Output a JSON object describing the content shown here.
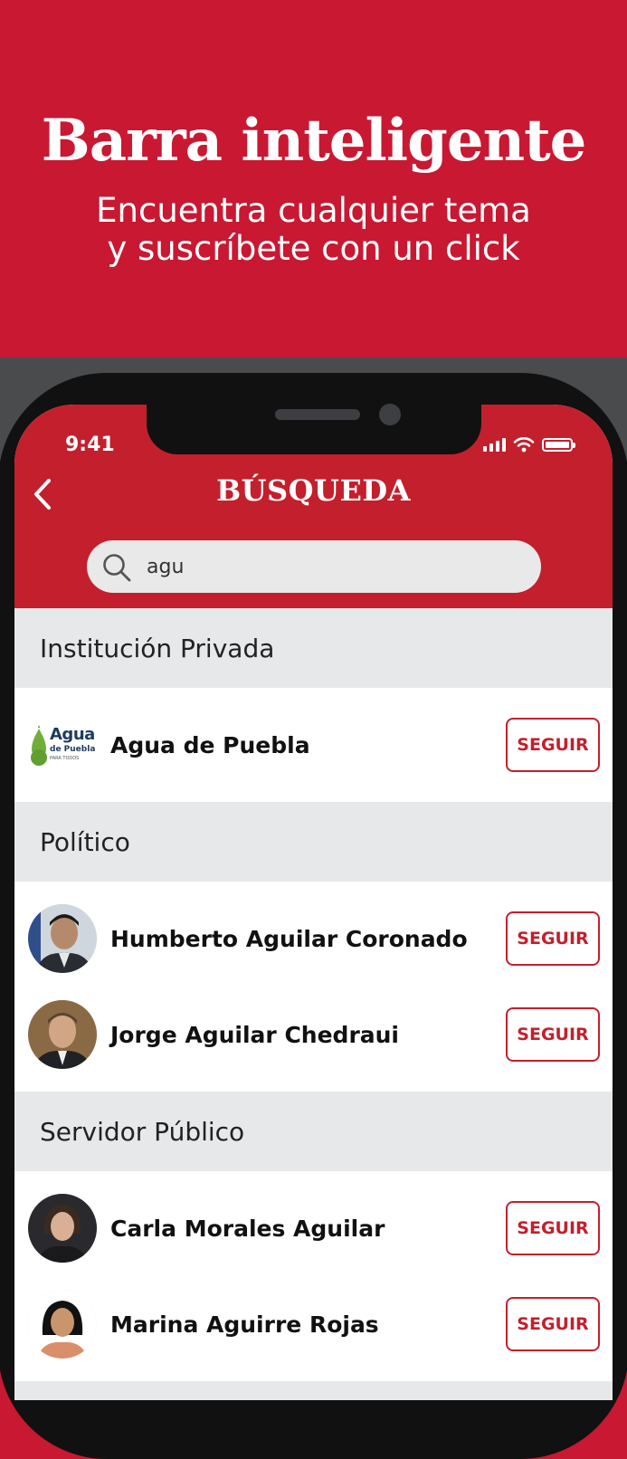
{
  "promo": {
    "title": "Barra inteligente",
    "subtitle_line1": "Encuentra cualquier tema",
    "subtitle_line2": "y suscríbete con un click"
  },
  "status_bar": {
    "time": "9:41"
  },
  "header": {
    "title": "BÚSQUEDA",
    "back_icon": "chevron-left-icon"
  },
  "search": {
    "value": "agu",
    "icon": "search-icon"
  },
  "sections": [
    {
      "title": "Institución Privada",
      "items": [
        {
          "name": "Agua de Puebla",
          "follow_label": "SEGUIR",
          "logo_text": "Agua",
          "logo_sub": "de Puebla",
          "logo_tag": "PARA TODOS"
        }
      ]
    },
    {
      "title": "Político",
      "items": [
        {
          "name": "Humberto Aguilar Coronado",
          "follow_label": "SEGUIR"
        },
        {
          "name": "Jorge Aguilar Chedraui",
          "follow_label": "SEGUIR"
        }
      ]
    },
    {
      "title": "Servidor Público",
      "items": [
        {
          "name": "Carla Morales Aguilar",
          "follow_label": "SEGUIR"
        },
        {
          "name": "Marina Aguirre Rojas",
          "follow_label": "SEGUIR"
        }
      ]
    }
  ],
  "colors": {
    "brand_red": "#c91832",
    "header_red": "#c41f2c",
    "section_gray": "#e7e8ea"
  }
}
